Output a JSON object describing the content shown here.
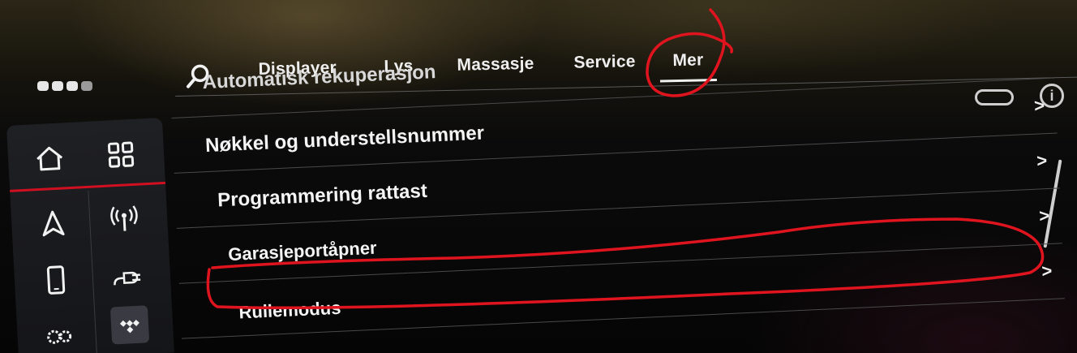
{
  "tabs": [
    {
      "label": "Displayer"
    },
    {
      "label": "Lys"
    },
    {
      "label": "Massasje"
    },
    {
      "label": "Service"
    },
    {
      "label": "Mer",
      "active": true
    }
  ],
  "list": {
    "items": [
      {
        "label": "Automatisk rekuperasjon"
      },
      {
        "label": "Nøkkel og understellsnummer",
        "chevron": ">"
      },
      {
        "label": "Programmering rattast",
        "chevron": ">"
      },
      {
        "label": "Garasjeportåpner",
        "chevron": ">"
      },
      {
        "label": "Rullemodus",
        "chevron": ">"
      }
    ]
  },
  "icons": {
    "search": "search-icon",
    "home": "home-icon",
    "apps": "apps-grid-icon",
    "navigation": "navigation-arrow-icon",
    "radio": "radio-signal-icon",
    "phone": "phone-icon",
    "charging": "charging-plug-icon",
    "settings": "gears-icon",
    "tidal": "tidal-icon",
    "info": "info-icon"
  },
  "colors": {
    "accent_red": "#d01020",
    "annotation_red": "#e0141e",
    "text": "#f2f2f2"
  },
  "info_glyph": "i"
}
